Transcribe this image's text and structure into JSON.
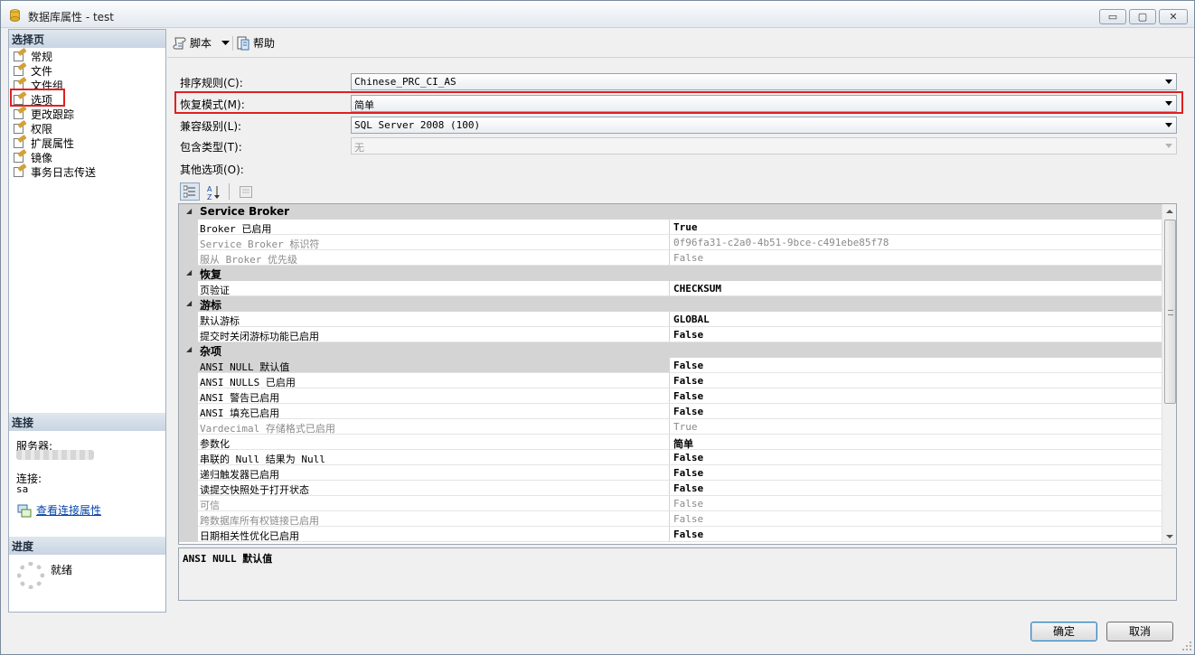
{
  "window": {
    "title": "数据库属性 - test"
  },
  "window_buttons": {
    "minimize": "▭",
    "maximize": "▢",
    "close": "✕"
  },
  "left": {
    "select_page_header": "选择页",
    "pages": [
      "常规",
      "文件",
      "文件组",
      "选项",
      "更改跟踪",
      "权限",
      "扩展属性",
      "镜像",
      "事务日志传送"
    ],
    "selected_page": "选项",
    "connection_header": "连接",
    "server_label": "服务器:",
    "connection_label": "连接:",
    "connection_value": "sa",
    "view_connection_link": "查看连接属性",
    "progress_header": "进度",
    "progress_status": "就绪"
  },
  "toolbar": {
    "script_label": "脚本",
    "help_label": "帮助"
  },
  "form": {
    "collation_label": "排序规则(C):",
    "collation_value": "Chinese_PRC_CI_AS",
    "recovery_label": "恢复模式(M):",
    "recovery_value": "简单",
    "compat_label": "兼容级别(L):",
    "compat_value": "SQL Server 2008 (100)",
    "containment_label": "包含类型(T):",
    "containment_value": "无",
    "other_options_label": "其他选项(O):"
  },
  "grid": {
    "categories": [
      {
        "label": "Service Broker",
        "rows": [
          {
            "name": "Broker 已启用",
            "value": "True",
            "bold": true
          },
          {
            "name": "Service Broker 标识符",
            "value": "0f96fa31-c2a0-4b51-9bce-c491ebe85f78",
            "dim": true
          },
          {
            "name": "服从 Broker 优先级",
            "value": "False",
            "dim": true
          }
        ]
      },
      {
        "label": "恢复",
        "rows": [
          {
            "name": "页验证",
            "value": "CHECKSUM",
            "bold": true
          }
        ]
      },
      {
        "label": "游标",
        "rows": [
          {
            "name": "默认游标",
            "value": "GLOBAL",
            "bold": true
          },
          {
            "name": "提交时关闭游标功能已启用",
            "value": "False",
            "bold": true
          }
        ]
      },
      {
        "label": "杂项",
        "rows": [
          {
            "name": "ANSI NULL 默认值",
            "value": "False",
            "bold": true,
            "selected": true
          },
          {
            "name": "ANSI NULLS 已启用",
            "value": "False",
            "bold": true
          },
          {
            "name": "ANSI 警告已启用",
            "value": "False",
            "bold": true
          },
          {
            "name": "ANSI 填充已启用",
            "value": "False",
            "bold": true
          },
          {
            "name": "Vardecimal 存储格式已启用",
            "value": "True",
            "dim": true
          },
          {
            "name": "参数化",
            "value": "简单",
            "bold": true
          },
          {
            "name": "串联的 Null 结果为 Null",
            "value": "False",
            "bold": true
          },
          {
            "name": "递归触发器已启用",
            "value": "False",
            "bold": true
          },
          {
            "name": "读提交快照处于打开状态",
            "value": "False",
            "bold": true
          },
          {
            "name": "可信",
            "value": "False",
            "dim": true
          },
          {
            "name": "跨数据库所有权链接已启用",
            "value": "False",
            "dim": true
          },
          {
            "name": "日期相关性优化已启用",
            "value": "False",
            "bold": true
          }
        ]
      }
    ]
  },
  "description": {
    "title": "ANSI NULL 默认值"
  },
  "buttons": {
    "ok": "确定",
    "cancel": "取消"
  },
  "colors": {
    "highlight_border": "#e02020",
    "category_bg": "#d4d4d4",
    "link": "#0645ad"
  }
}
